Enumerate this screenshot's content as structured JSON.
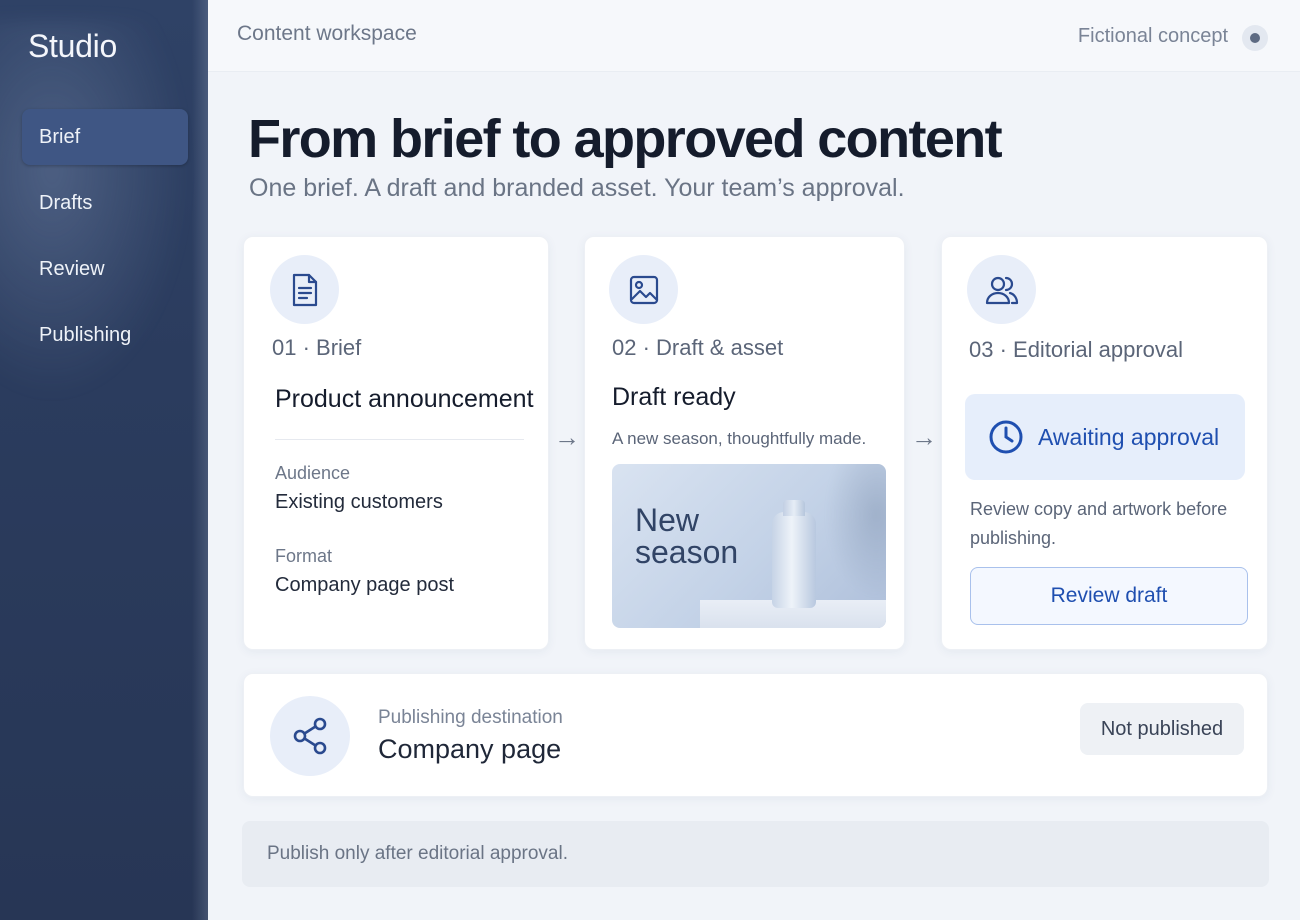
{
  "sidebar": {
    "app_title": "Studio",
    "items": [
      {
        "label": "Brief",
        "active": true
      },
      {
        "label": "Drafts",
        "active": false
      },
      {
        "label": "Review",
        "active": false
      },
      {
        "label": "Publishing",
        "active": false
      }
    ]
  },
  "topbar": {
    "workspace": "Content workspace",
    "concept_label": "Fictional concept"
  },
  "header": {
    "title": "From brief to approved content",
    "subtitle": "One brief. A draft and branded asset. Your team’s approval."
  },
  "steps": {
    "brief": {
      "icon": "document-icon",
      "step": "01 · Brief",
      "heading": "Product announcement",
      "fields": [
        {
          "label": "Audience",
          "value": "Existing customers"
        },
        {
          "label": "Format",
          "value": "Company page post"
        }
      ]
    },
    "draft": {
      "icon": "image-icon",
      "step": "02 · Draft & asset",
      "heading": "Draft ready",
      "caption": "A new season, thoughtfully made.",
      "asset_text": "New season"
    },
    "approval": {
      "icon": "users-icon",
      "step": "03 · Editorial approval",
      "status": "Awaiting approval",
      "status_icon": "clock-icon",
      "note": "Review copy and artwork before publishing.",
      "button": "Review draft"
    }
  },
  "destination": {
    "icon": "share-icon",
    "label": "Publishing destination",
    "value": "Company page",
    "status": "Not published"
  },
  "footer": {
    "note": "Publish only after editorial approval."
  },
  "colors": {
    "sidebar": "#2f4266",
    "accent": "#1f4fb0",
    "icon_bg": "#e8eef9"
  }
}
